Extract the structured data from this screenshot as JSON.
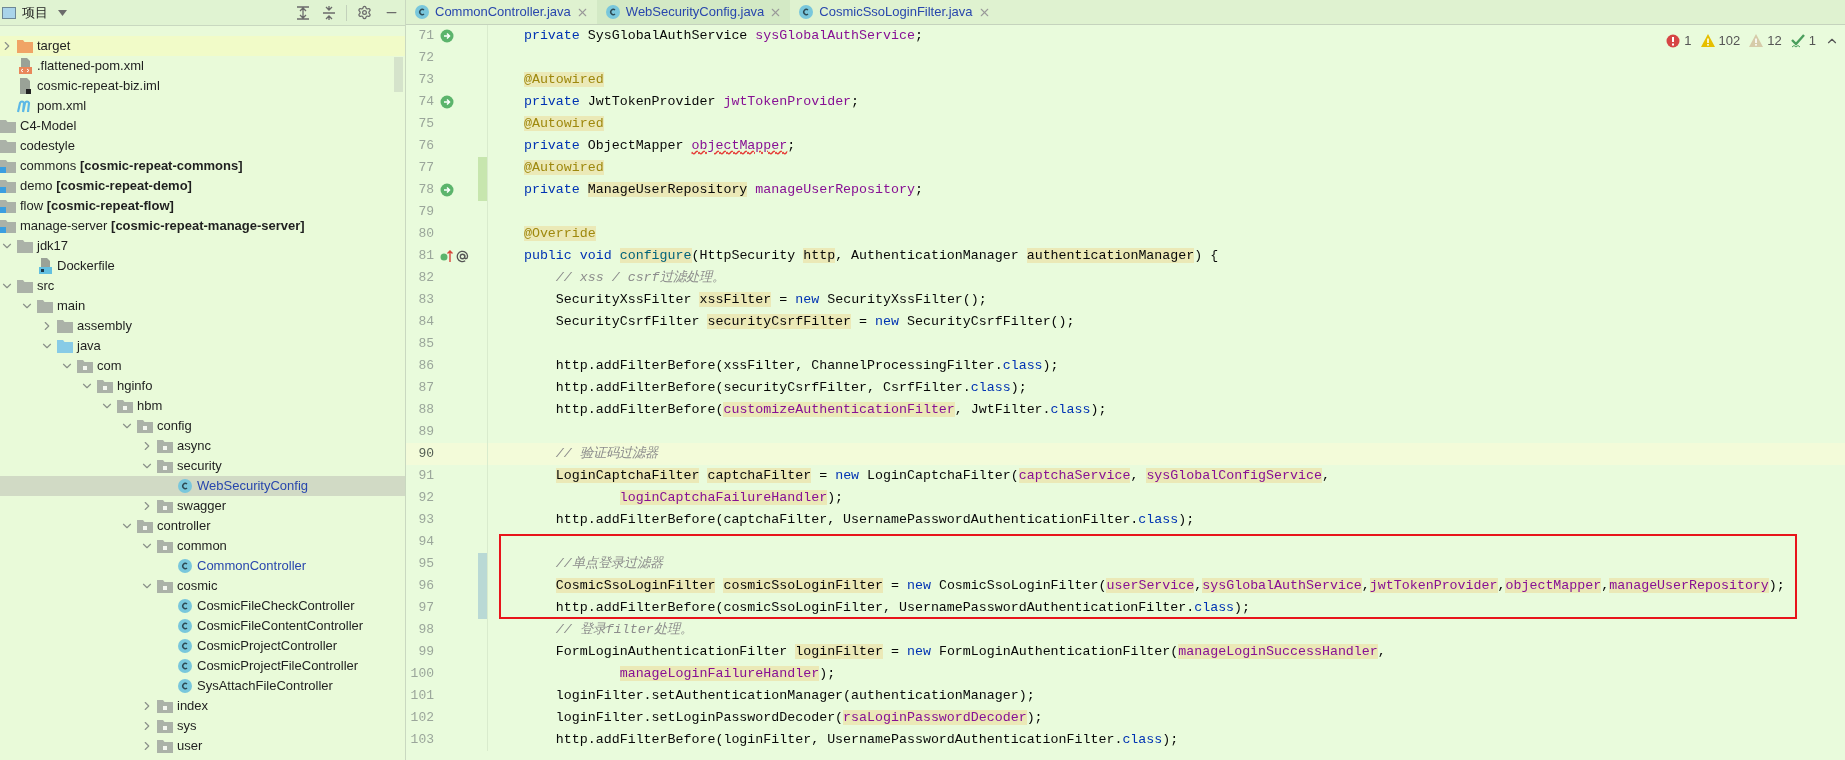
{
  "sidebar": {
    "title": "项目",
    "continued_items": [
      {
        "label": "target",
        "kind": "excluded",
        "expanded": false,
        "selected": false,
        "hovered": true,
        "modified": false
      },
      {
        "label": ".flattened-pom.xml",
        "kind": "xml",
        "selected": false,
        "hovered": false,
        "modified": false
      },
      {
        "label": "cosmic-repeat-biz.iml",
        "kind": "iml",
        "selected": false,
        "hovered": false,
        "modified": false
      },
      {
        "label": "pom.xml",
        "kind": "maven",
        "selected": false,
        "hovered": false,
        "modified": false
      }
    ],
    "items": [
      {
        "label": "C4-Model",
        "kind": "folder",
        "selected": false,
        "hovered": false,
        "modified": false
      },
      {
        "label": "codestyle",
        "kind": "folder",
        "selected": false,
        "hovered": false,
        "modified": false
      },
      {
        "label": "commons **[cosmic-repeat-commons]**",
        "kind": "module",
        "selected": false,
        "hovered": false,
        "modified": false
      },
      {
        "label": "demo **[cosmic-repeat-demo]**",
        "kind": "module",
        "selected": false,
        "hovered": false,
        "modified": false
      },
      {
        "label": "flow **[cosmic-repeat-flow]**",
        "kind": "module",
        "selected": false,
        "hovered": false,
        "modified": false
      },
      {
        "label": "manage-server **[cosmic-repeat-manage-server]**",
        "kind": "module",
        "selected": false,
        "hovered": false,
        "modified": false,
        "children": [
          {
            "label": "jdk17",
            "kind": "folder",
            "expanded": true,
            "selected": false,
            "hovered": false,
            "modified": false,
            "children": [
              {
                "label": "Dockerfile",
                "kind": "docker",
                "selected": false,
                "hovered": false,
                "modified": false
              }
            ]
          },
          {
            "label": "src",
            "kind": "folder",
            "expanded": true,
            "selected": false,
            "hovered": false,
            "modified": false,
            "children": [
              {
                "label": "main",
                "kind": "folder",
                "expanded": true,
                "selected": false,
                "hovered": false,
                "modified": false,
                "children": [
                  {
                    "label": "assembly",
                    "kind": "folder",
                    "expanded": false,
                    "selected": false,
                    "hovered": false,
                    "modified": false
                  },
                  {
                    "label": "java",
                    "kind": "source-root",
                    "expanded": true,
                    "selected": false,
                    "hovered": false,
                    "modified": false,
                    "children": [
                      {
                        "label": "com",
                        "kind": "package",
                        "expanded": true,
                        "selected": false,
                        "hovered": false,
                        "modified": false,
                        "children": [
                          {
                            "label": "hginfo",
                            "kind": "package",
                            "expanded": true,
                            "selected": false,
                            "hovered": false,
                            "modified": false,
                            "children": [
                              {
                                "label": "hbm",
                                "kind": "package",
                                "expanded": true,
                                "selected": false,
                                "hovered": false,
                                "modified": false,
                                "children": [
                                  {
                                    "label": "config",
                                    "kind": "package",
                                    "expanded": true,
                                    "selected": false,
                                    "hovered": false,
                                    "modified": false,
                                    "children": [
                                      {
                                        "label": "async",
                                        "kind": "package",
                                        "expanded": false,
                                        "selected": false,
                                        "hovered": false,
                                        "modified": false
                                      },
                                      {
                                        "label": "security",
                                        "kind": "package",
                                        "expanded": true,
                                        "selected": false,
                                        "hovered": false,
                                        "modified": false,
                                        "children": [
                                          {
                                            "label": "WebSecurityConfig",
                                            "kind": "class",
                                            "selected": true,
                                            "hovered": false,
                                            "modified": true
                                          }
                                        ]
                                      },
                                      {
                                        "label": "swagger",
                                        "kind": "package",
                                        "expanded": false,
                                        "selected": false,
                                        "hovered": false,
                                        "modified": false
                                      }
                                    ]
                                  },
                                  {
                                    "label": "controller",
                                    "kind": "package",
                                    "expanded": true,
                                    "selected": false,
                                    "hovered": false,
                                    "modified": false,
                                    "children": [
                                      {
                                        "label": "common",
                                        "kind": "package",
                                        "expanded": true,
                                        "selected": false,
                                        "hovered": false,
                                        "modified": false,
                                        "children": [
                                          {
                                            "label": "CommonController",
                                            "kind": "class",
                                            "selected": false,
                                            "hovered": false,
                                            "modified": true
                                          }
                                        ]
                                      },
                                      {
                                        "label": "cosmic",
                                        "kind": "package",
                                        "expanded": true,
                                        "selected": false,
                                        "hovered": false,
                                        "modified": false,
                                        "children": [
                                          {
                                            "label": "CosmicFileCheckController",
                                            "kind": "class",
                                            "selected": false,
                                            "hovered": false,
                                            "modified": false
                                          },
                                          {
                                            "label": "CosmicFileContentController",
                                            "kind": "class",
                                            "selected": false,
                                            "hovered": false,
                                            "modified": false
                                          },
                                          {
                                            "label": "CosmicProjectController",
                                            "kind": "class",
                                            "selected": false,
                                            "hovered": false,
                                            "modified": false
                                          },
                                          {
                                            "label": "CosmicProjectFileController",
                                            "kind": "class",
                                            "selected": false,
                                            "hovered": false,
                                            "modified": false
                                          },
                                          {
                                            "label": "SysAttachFileController",
                                            "kind": "class",
                                            "selected": false,
                                            "hovered": false,
                                            "modified": false
                                          }
                                        ]
                                      },
                                      {
                                        "label": "index",
                                        "kind": "package",
                                        "expanded": false,
                                        "selected": false,
                                        "hovered": false,
                                        "modified": false
                                      },
                                      {
                                        "label": "sys",
                                        "kind": "package",
                                        "expanded": false,
                                        "selected": false,
                                        "hovered": false,
                                        "modified": false
                                      },
                                      {
                                        "label": "user",
                                        "kind": "package",
                                        "expanded": false,
                                        "selected": false,
                                        "hovered": false,
                                        "modified": false
                                      }
                                    ]
                                  }
                                ]
                              }
                            ]
                          }
                        ]
                      }
                    ]
                  }
                ]
              }
            ]
          }
        ]
      }
    ]
  },
  "tabs": [
    {
      "label": "CommonController.java",
      "selected": false
    },
    {
      "label": "WebSecurityConfig.java",
      "selected": true
    },
    {
      "label": "CosmicSsoLoginFilter.java",
      "selected": false
    }
  ],
  "inspections": [
    {
      "kind": "error",
      "count": "1"
    },
    {
      "kind": "warning",
      "count": "102"
    },
    {
      "kind": "weak",
      "count": "12"
    },
    {
      "kind": "typo",
      "count": "1"
    }
  ],
  "segments": [
    {
      "boxed": false,
      "lines": [
        {
          "number": "71",
          "kind": "bean",
          "current": false,
          "tokens": [
            {
              "text": "    private ",
              "kind": "keyword",
              "marked": false
            },
            {
              "text": "SysGlobalAuthService ",
              "kind": "plain",
              "marked": false
            },
            {
              "text": "sysGlobalAuthService",
              "kind": "field",
              "marked": false
            },
            {
              "text": ";",
              "kind": "plain",
              "marked": false
            }
          ]
        },
        {
          "number": "72",
          "kind": "plain",
          "current": false
        },
        {
          "number": "73",
          "kind": "plain",
          "current": false,
          "tokens": [
            {
              "text": "    @Autowired",
              "kind": "annotation",
              "marked": true
            }
          ]
        },
        {
          "number": "74",
          "kind": "bean",
          "current": false,
          "tokens": [
            {
              "text": "    private ",
              "kind": "keyword",
              "marked": false
            },
            {
              "text": "JwtTokenProvider ",
              "kind": "plain",
              "marked": false
            },
            {
              "text": "jwtTokenProvider",
              "kind": "field",
              "marked": false
            },
            {
              "text": ";",
              "kind": "plain",
              "marked": false
            }
          ]
        },
        {
          "number": "75",
          "kind": "plain",
          "current": false,
          "tokens": [
            {
              "text": "    @Autowired",
              "kind": "annotation",
              "marked": true
            }
          ]
        },
        {
          "number": "76",
          "kind": "plain",
          "current": false,
          "tokens": [
            {
              "text": "    private ",
              "kind": "keyword",
              "marked": false
            },
            {
              "text": "ObjectMapper ",
              "kind": "plain",
              "marked": false
            },
            {
              "text": "objectMapper",
              "kind": "typo",
              "marked": false
            },
            {
              "text": ";",
              "kind": "plain",
              "marked": false
            }
          ]
        },
        {
          "number": "77",
          "kind": "plain",
          "current": false,
          "color": "#c7e6ae",
          "tokens": [
            {
              "text": "    @Autowired",
              "kind": "annotation",
              "marked": true
            }
          ]
        },
        {
          "number": "78",
          "kind": "bean",
          "current": false,
          "color": "#c7e6ae",
          "tokens": [
            {
              "text": "    private ",
              "kind": "keyword",
              "marked": false
            },
            {
              "text": "ManageUserRepository",
              "kind": "plain",
              "marked": true
            },
            {
              "text": " manageUserRepository",
              "kind": "field",
              "marked": false
            },
            {
              "text": ";",
              "kind": "plain",
              "marked": false
            }
          ]
        },
        {
          "number": "79",
          "kind": "plain",
          "current": false
        },
        {
          "number": "80",
          "kind": "plain",
          "current": false,
          "tokens": [
            {
              "text": "    @Override",
              "kind": "annotation",
              "marked": true
            }
          ]
        },
        {
          "number": "81",
          "kind": "override",
          "current": false,
          "tokens": [
            {
              "text": "    public void ",
              "kind": "keyword",
              "marked": false
            },
            {
              "text": "configure",
              "kind": "method",
              "marked": true
            },
            {
              "text": "(HttpSecurity ",
              "kind": "plain",
              "marked": false
            },
            {
              "text": "http",
              "kind": "plain",
              "marked": true
            },
            {
              "text": ", AuthenticationManager ",
              "kind": "plain",
              "marked": false
            },
            {
              "text": "authenticationManager",
              "kind": "plain",
              "marked": true
            },
            {
              "text": ") {",
              "kind": "plain",
              "marked": false
            }
          ]
        },
        {
          "number": "82",
          "kind": "plain",
          "current": false,
          "tokens": [
            {
              "text": "        // xss / csrf过滤处理。",
              "kind": "comment",
              "marked": false
            }
          ]
        },
        {
          "number": "83",
          "kind": "plain",
          "current": false,
          "tokens": [
            {
              "text": "        SecurityXssFilter ",
              "kind": "plain",
              "marked": false
            },
            {
              "text": "xssFilter",
              "kind": "plain",
              "marked": true
            },
            {
              "text": " = ",
              "kind": "plain",
              "marked": false
            },
            {
              "text": "new",
              "kind": "keyword",
              "marked": false
            },
            {
              "text": " SecurityXssFilter();",
              "kind": "plain",
              "marked": false
            }
          ]
        },
        {
          "number": "84",
          "kind": "plain",
          "current": false,
          "tokens": [
            {
              "text": "        SecurityCsrfFilter ",
              "kind": "plain",
              "marked": false
            },
            {
              "text": "securityCsrfFilter",
              "kind": "plain",
              "marked": true
            },
            {
              "text": " = ",
              "kind": "plain",
              "marked": false
            },
            {
              "text": "new",
              "kind": "keyword",
              "marked": false
            },
            {
              "text": " SecurityCsrfFilter();",
              "kind": "plain",
              "marked": false
            }
          ]
        },
        {
          "number": "85",
          "kind": "plain",
          "current": false
        },
        {
          "number": "86",
          "kind": "plain",
          "current": false,
          "tokens": [
            {
              "text": "        http.addFilterBefore(xssFilter, ChannelProcessingFilter.",
              "kind": "plain",
              "marked": false
            },
            {
              "text": "class",
              "kind": "keyword",
              "marked": false
            },
            {
              "text": ");",
              "kind": "plain",
              "marked": false
            }
          ]
        },
        {
          "number": "87",
          "kind": "plain",
          "current": false,
          "tokens": [
            {
              "text": "        http.addFilterBefore(securityCsrfFilter, CsrfFilter.",
              "kind": "plain",
              "marked": false
            },
            {
              "text": "class",
              "kind": "keyword",
              "marked": false
            },
            {
              "text": ");",
              "kind": "plain",
              "marked": false
            }
          ]
        },
        {
          "number": "88",
          "kind": "plain",
          "current": false,
          "tokens": [
            {
              "text": "        http.addFilterBefore(",
              "kind": "plain",
              "marked": false
            },
            {
              "text": "customizeAuthenticationFilter",
              "kind": "field",
              "marked": true
            },
            {
              "text": ", JwtFilter.",
              "kind": "plain",
              "marked": false
            },
            {
              "text": "class",
              "kind": "keyword",
              "marked": false
            },
            {
              "text": ");",
              "kind": "plain",
              "marked": false
            }
          ]
        },
        {
          "number": "89",
          "kind": "plain",
          "current": false
        },
        {
          "number": "90",
          "kind": "plain",
          "current": true,
          "tokens": [
            {
              "text": "        // 验证码过滤器",
              "kind": "comment",
              "marked": false
            }
          ]
        },
        {
          "number": "91",
          "kind": "plain",
          "current": false,
          "tokens": [
            {
              "text": "        LoginCaptchaFilter",
              "kind": "plain",
              "marked": true
            },
            {
              "text": " captchaFilter",
              "kind": "plain",
              "marked": true
            },
            {
              "text": " = ",
              "kind": "plain",
              "marked": false
            },
            {
              "text": "new",
              "kind": "keyword",
              "marked": false
            },
            {
              "text": " LoginCaptchaFilter(",
              "kind": "plain",
              "marked": false
            },
            {
              "text": "captchaService",
              "kind": "field",
              "marked": true
            },
            {
              "text": ", ",
              "kind": "plain",
              "marked": false
            },
            {
              "text": "sysGlobalConfigService",
              "kind": "field",
              "marked": true
            },
            {
              "text": ",",
              "kind": "plain",
              "marked": false
            }
          ]
        },
        {
          "number": "92",
          "kind": "plain",
          "current": false,
          "tokens": [
            {
              "text": "                loginCaptchaFailureHandler",
              "kind": "field",
              "marked": true
            },
            {
              "text": ");",
              "kind": "plain",
              "marked": false
            }
          ]
        },
        {
          "number": "93",
          "kind": "plain",
          "current": false,
          "tokens": [
            {
              "text": "        http.addFilterBefore(captchaFilter, UsernamePasswordAuthenticationFilter.",
              "kind": "plain",
              "marked": false
            },
            {
              "text": "class",
              "kind": "keyword",
              "marked": false
            },
            {
              "text": ");",
              "kind": "plain",
              "marked": false
            }
          ]
        }
      ]
    },
    {
      "boxed": true,
      "lines": [
        {
          "number": "94",
          "kind": "plain",
          "current": false
        },
        {
          "number": "95",
          "kind": "plain",
          "current": false,
          "color": "#b9d9d5",
          "tokens": [
            {
              "text": "        //单点登录过滤器",
              "kind": "comment",
              "marked": false
            }
          ]
        },
        {
          "number": "96",
          "kind": "plain",
          "current": false,
          "color": "#b9d9d5",
          "tokens": [
            {
              "text": "        CosmicSsoLoginFilter",
              "kind": "plain",
              "marked": true
            },
            {
              "text": " cosmicSsoLoginFilter",
              "kind": "plain",
              "marked": true
            },
            {
              "text": " = ",
              "kind": "plain",
              "marked": false
            },
            {
              "text": "new",
              "kind": "keyword",
              "marked": false
            },
            {
              "text": " CosmicSsoLoginFilter(",
              "kind": "plain",
              "marked": false
            },
            {
              "text": "userService",
              "kind": "field",
              "marked": true
            },
            {
              "text": ",",
              "kind": "plain",
              "marked": false
            },
            {
              "text": "sysGlobalAuthService",
              "kind": "field",
              "marked": true
            },
            {
              "text": ",",
              "kind": "plain",
              "marked": false
            },
            {
              "text": "jwtTokenProvider",
              "kind": "field",
              "marked": true
            },
            {
              "text": ",",
              "kind": "plain",
              "marked": false
            },
            {
              "text": "objectMapper",
              "kind": "field",
              "marked": true
            },
            {
              "text": ",",
              "kind": "plain",
              "marked": false
            },
            {
              "text": "manageUserRepository",
              "kind": "field",
              "marked": true
            },
            {
              "text": ");",
              "kind": "plain",
              "marked": false
            }
          ]
        },
        {
          "number": "97",
          "kind": "plain",
          "current": false,
          "color": "#b9d9d5",
          "tokens": [
            {
              "text": "        http.addFilterBefore(cosmicSsoLoginFilter, UsernamePasswordAuthenticationFilter.",
              "kind": "plain",
              "marked": false
            },
            {
              "text": "class",
              "kind": "keyword",
              "marked": false
            },
            {
              "text": ");",
              "kind": "plain",
              "marked": false
            }
          ]
        }
      ]
    },
    {
      "boxed": false,
      "lines": [
        {
          "number": "98",
          "kind": "plain",
          "current": false,
          "tokens": [
            {
              "text": "        // 登录filter处理。",
              "kind": "comment",
              "marked": false
            }
          ]
        },
        {
          "number": "99",
          "kind": "plain",
          "current": false,
          "tokens": [
            {
              "text": "        FormLoginAuthenticationFilter ",
              "kind": "plain",
              "marked": false
            },
            {
              "text": "loginFilter",
              "kind": "plain",
              "marked": true
            },
            {
              "text": " = ",
              "kind": "plain",
              "marked": false
            },
            {
              "text": "new",
              "kind": "keyword",
              "marked": false
            },
            {
              "text": " FormLoginAuthenticationFilter(",
              "kind": "plain",
              "marked": false
            },
            {
              "text": "manageLoginSuccessHandler",
              "kind": "field",
              "marked": true
            },
            {
              "text": ",",
              "kind": "plain",
              "marked": false
            }
          ]
        },
        {
          "number": "100",
          "kind": "plain",
          "current": false,
          "tokens": [
            {
              "text": "                manageLoginFailureHandler",
              "kind": "field",
              "marked": true
            },
            {
              "text": ");",
              "kind": "plain",
              "marked": false
            }
          ]
        },
        {
          "number": "101",
          "kind": "plain",
          "current": false,
          "tokens": [
            {
              "text": "        loginFilter.setAuthenticationManager(authenticationManager);",
              "kind": "plain",
              "marked": false
            }
          ]
        },
        {
          "number": "102",
          "kind": "plain",
          "current": false,
          "tokens": [
            {
              "text": "        loginFilter.setLoginPasswordDecoder(",
              "kind": "plain",
              "marked": false
            },
            {
              "text": "rsaLoginPasswordDecoder",
              "kind": "field",
              "marked": true
            },
            {
              "text": ");",
              "kind": "plain",
              "marked": false
            }
          ]
        },
        {
          "number": "103",
          "kind": "plain",
          "current": false,
          "tokens": [
            {
              "text": "        http.addFilterBefore(loginFilter, UsernamePasswordAuthenticationFilter.",
              "kind": "plain",
              "marked": false
            },
            {
              "text": "class",
              "kind": "keyword",
              "marked": false
            },
            {
              "text": ");",
              "kind": "plain",
              "marked": false
            }
          ]
        }
      ]
    }
  ]
}
